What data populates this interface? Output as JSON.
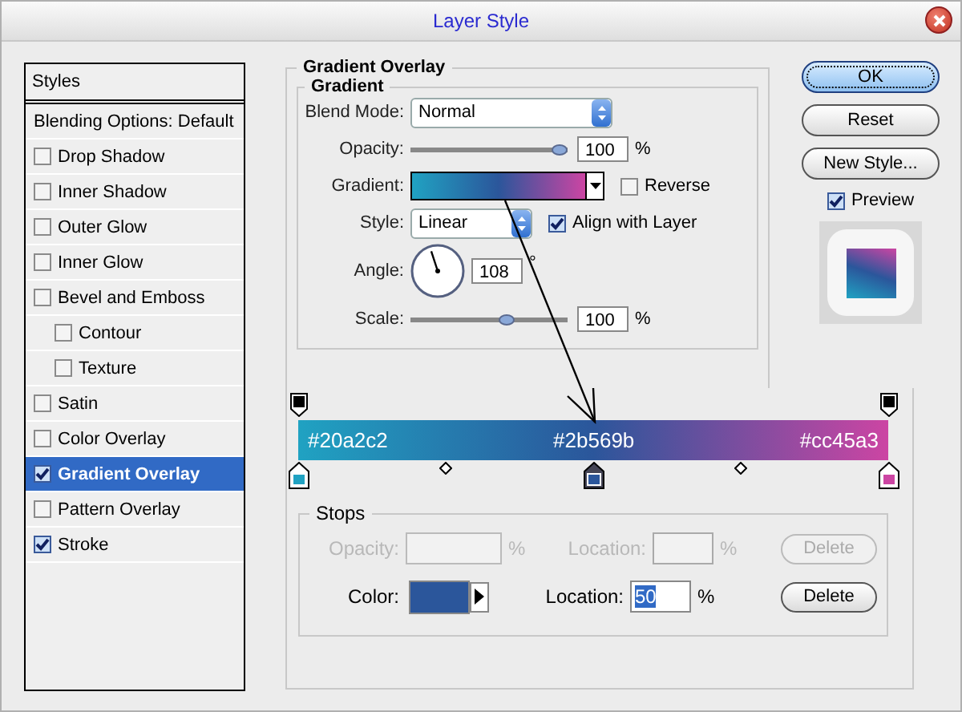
{
  "window": {
    "title": "Layer Style"
  },
  "styles": {
    "header": "Styles",
    "items": [
      {
        "label": "Blending Options: Default",
        "kind": "plain",
        "selected": false
      },
      {
        "label": "Drop Shadow",
        "kind": "check",
        "checked": false,
        "selected": false
      },
      {
        "label": "Inner Shadow",
        "kind": "check",
        "checked": false,
        "selected": false
      },
      {
        "label": "Outer Glow",
        "kind": "check",
        "checked": false,
        "selected": false
      },
      {
        "label": "Inner Glow",
        "kind": "check",
        "checked": false,
        "selected": false
      },
      {
        "label": "Bevel and Emboss",
        "kind": "check",
        "checked": false,
        "selected": false,
        "children": [
          {
            "label": "Contour",
            "kind": "check",
            "checked": false,
            "selected": false
          },
          {
            "label": "Texture",
            "kind": "check",
            "checked": false,
            "selected": false
          }
        ]
      },
      {
        "label": "Satin",
        "kind": "check",
        "checked": false,
        "selected": false
      },
      {
        "label": "Color Overlay",
        "kind": "check",
        "checked": false,
        "selected": false
      },
      {
        "label": "Gradient Overlay",
        "kind": "check",
        "checked": true,
        "selected": true
      },
      {
        "label": "Pattern Overlay",
        "kind": "check",
        "checked": false,
        "selected": false
      },
      {
        "label": "Stroke",
        "kind": "check",
        "checked": true,
        "selected": false
      }
    ]
  },
  "gradient_overlay": {
    "title": "Gradient Overlay",
    "section": "Gradient",
    "blend_mode": {
      "label": "Blend Mode:",
      "value": "Normal"
    },
    "opacity": {
      "label": "Opacity:",
      "level": 1,
      "value": "100",
      "unit": "%"
    },
    "gradient": {
      "label": "Gradient:",
      "reverse": {
        "label": "Reverse",
        "checked": false
      }
    },
    "style": {
      "label": "Style:",
      "value": "Linear",
      "align": {
        "label": "Align with Layer",
        "checked": true
      }
    },
    "angle": {
      "label": "Angle:",
      "value": "108",
      "unit": "°"
    },
    "scale": {
      "label": "Scale:",
      "level": 0.62,
      "value": "100",
      "unit": "%"
    }
  },
  "gradient_editor": {
    "opacity_stops": [
      {
        "color": "#000000",
        "selected": false
      },
      {
        "color": "#000000",
        "selected": false
      }
    ],
    "color_stops": [
      {
        "label": "#20a2c2",
        "color": "#20a2c2",
        "selected": false
      },
      {
        "label": "#2b569b",
        "color": "#2b569b",
        "selected": true
      },
      {
        "label": "#cc45a3",
        "color": "#cc45a3",
        "selected": false
      }
    ]
  },
  "stops": {
    "title": "Stops",
    "opacity": {
      "label": "Opacity:",
      "unit": "%",
      "disabled": true
    },
    "opacity_location": {
      "label": "Location:",
      "unit": "%",
      "disabled": true
    },
    "opacity_delete": {
      "label": "Delete",
      "disabled": true
    },
    "color": {
      "label": "Color:",
      "color": "#2b569b"
    },
    "color_location": {
      "label": "Location:",
      "value": "50",
      "unit": "%"
    },
    "color_delete": {
      "label": "Delete",
      "disabled": false
    }
  },
  "buttons": [
    {
      "label": "OK",
      "default": true
    },
    {
      "label": "Reset",
      "default": false
    },
    {
      "label": "New Style...",
      "default": false
    }
  ],
  "preview": {
    "label": "Preview",
    "checked": true
  }
}
